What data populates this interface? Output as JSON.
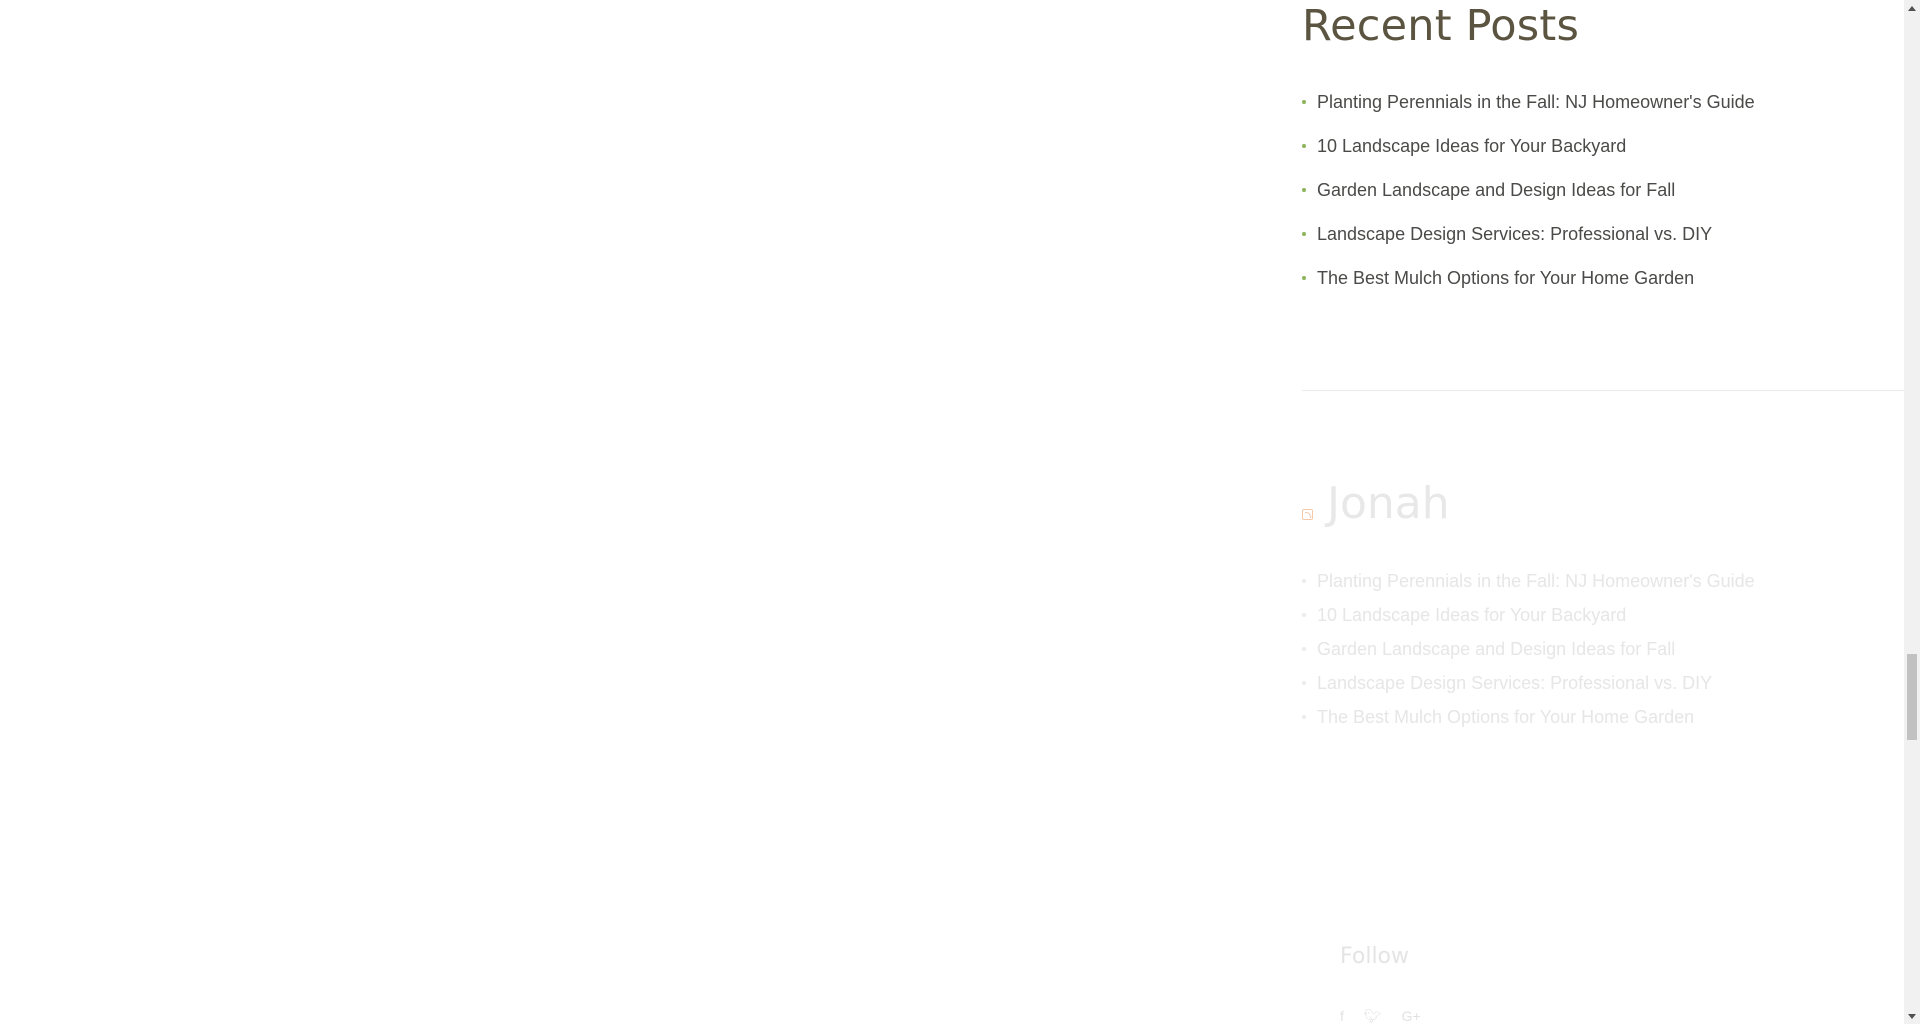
{
  "recent_posts": {
    "title": "Recent Posts",
    "items": [
      {
        "label": "Planting Perennials in the Fall: NJ Homeowner's Guide"
      },
      {
        "label": "10 Landscape Ideas for Your Backyard"
      },
      {
        "label": "Garden Landscape and Design Ideas for Fall"
      },
      {
        "label": "Landscape Design Services: Professional vs. DIY"
      },
      {
        "label": "The Best Mulch Options for Your Home Garden"
      }
    ]
  },
  "rss_widget": {
    "title": "Jonah",
    "items": [
      {
        "label": "Planting Perennials in the Fall: NJ Homeowner's Guide"
      },
      {
        "label": "10 Landscape Ideas for Your Backyard"
      },
      {
        "label": "Garden Landscape and Design Ideas for Fall"
      },
      {
        "label": "Landscape Design Services: Professional vs. DIY"
      },
      {
        "label": "The Best Mulch Options for Your Home Garden"
      }
    ]
  },
  "follow": {
    "label": "Follow",
    "icons": [
      "facebook-icon",
      "twitter-icon",
      "google-plus-icon"
    ]
  },
  "colors": {
    "heading": "#5b5440",
    "link": "#4a4a48",
    "bullet_accent": "#8ab55a",
    "rss_icon": "#f5c8a8"
  }
}
